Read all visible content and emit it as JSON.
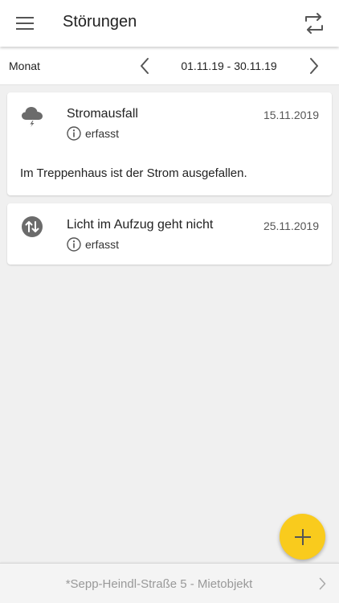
{
  "header": {
    "title": "Störungen",
    "menu_icon": "hamburger-menu-icon",
    "sync_icon": "sync-icon"
  },
  "filter": {
    "period_label": "Monat",
    "range": "01.11.19 - 30.11.19"
  },
  "issues": [
    {
      "title": "Stromausfall",
      "date": "15.11.2019",
      "status": "erfasst",
      "description": "Im Treppenhaus ist der Strom ausgefallen.",
      "category_icon": "storm-cloud-icon"
    },
    {
      "title": "Licht im Aufzug geht nicht",
      "date": "25.11.2019",
      "status": "erfasst",
      "category_icon": "elevator-icon"
    }
  ],
  "footer": {
    "property": "*Sepp-Heindl-Straße 5 - Mietobjekt"
  },
  "colors": {
    "fab": "#f9cb1d",
    "icon_gray": "#666666",
    "background": "#f0f0f0"
  }
}
